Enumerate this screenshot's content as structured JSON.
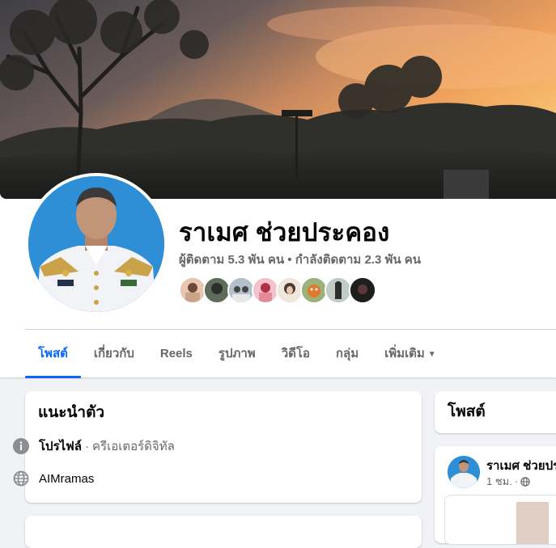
{
  "profile": {
    "name": "ราเมศ ช่วยประคอง",
    "followers_text": "ผู้ติดตาม 5.3 พัน คน",
    "separator": "•",
    "following_text": "กำลังติดตาม 2.3 พัน คน",
    "friend_avatars": [
      "friend-1",
      "friend-2",
      "friend-3",
      "friend-4",
      "friend-5",
      "friend-6",
      "friend-7",
      "friend-8"
    ]
  },
  "tabs": [
    {
      "label": "โพสต์",
      "active": true
    },
    {
      "label": "เกี่ยวกับ",
      "active": false
    },
    {
      "label": "Reels",
      "active": false
    },
    {
      "label": "รูปภาพ",
      "active": false
    },
    {
      "label": "วิดีโอ",
      "active": false
    },
    {
      "label": "กลุ่ม",
      "active": false
    },
    {
      "label": "เพิ่มเติม",
      "active": false
    }
  ],
  "intro": {
    "title": "แนะนำตัว",
    "profile_label": "โปรไฟล์",
    "profile_sep": "·",
    "profile_category": "ครีเอเตอร์ดิจิทัล",
    "website": "AIMramas"
  },
  "posts_card": {
    "title": "โพสต์"
  },
  "post": {
    "author": "ราเมศ ช่วยปร",
    "time": "1 ชม.",
    "dot": "·"
  },
  "colors": {
    "accent": "#0866ff",
    "text_primary": "#050505",
    "text_secondary": "#65676b",
    "page_bg": "#f0f2f5",
    "card_bg": "#ffffff",
    "avatar_bg": "#2f8fd6"
  },
  "icons": {
    "intro_profile": "info-icon",
    "intro_website": "globe-icon",
    "more_tab": "caret-down-icon",
    "post_privacy": "globe-icon"
  }
}
